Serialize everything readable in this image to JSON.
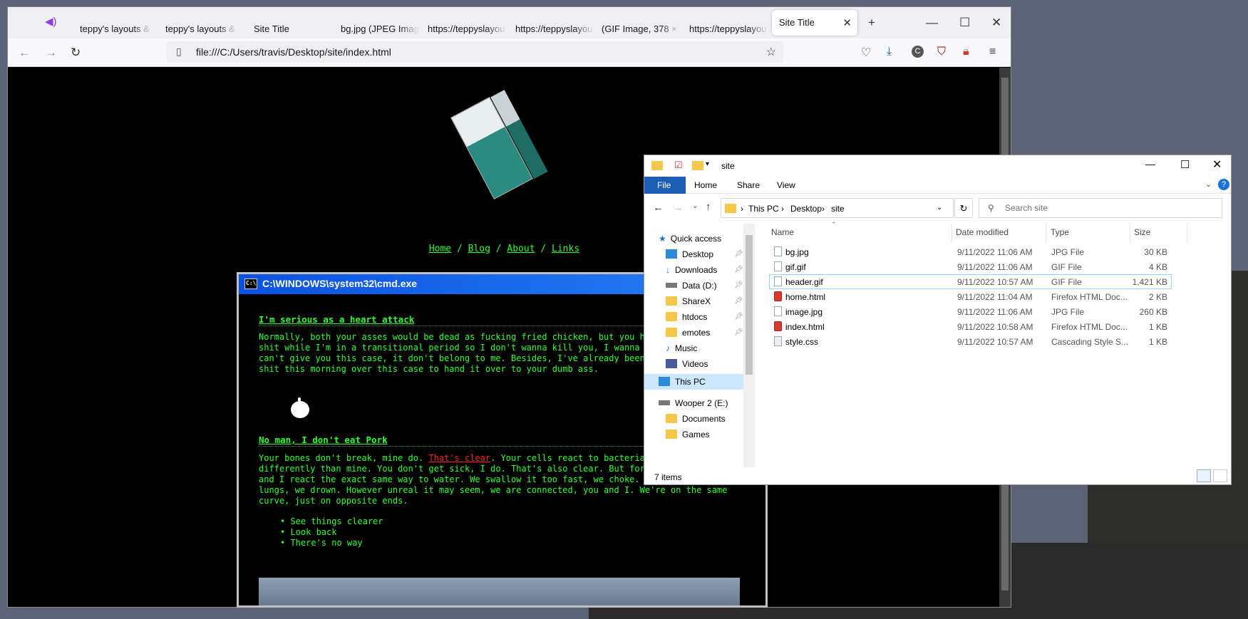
{
  "browser": {
    "tabs": [
      {
        "label": "teppy's layouts & t"
      },
      {
        "label": "teppy's layouts & t"
      },
      {
        "label": "Site Title"
      },
      {
        "label": "bg.jpg (JPEG Image"
      },
      {
        "label": "https://teppyslayou"
      },
      {
        "label": "https://teppyslayou"
      },
      {
        "label": "(GIF Image, 378 × 3"
      },
      {
        "label": "https://teppyslayou"
      },
      {
        "label": "Site Title"
      }
    ],
    "url": "file:///C:/Users/travis/Desktop/site/index.html"
  },
  "site": {
    "nav": [
      "Home",
      "Blog",
      "About",
      "Links"
    ],
    "nav_sep": "/"
  },
  "cmd": {
    "title": "C:\\WINDOWS\\system32\\cmd.exe",
    "heading1": "I'm serious as a heart attack",
    "para1": "Normally, both your asses would be dead as fucking fried chicken, but you ha\nshit while I'm in a transitional period so I don't wanna kill you, I wanna h\ncan't give you this case, it don't belong to me. Besides, I've already been\nshit this morning over this case to hand it over to your dumb ass.",
    "heading2": "No man, I don't eat Pork",
    "para2_a": "Your bones don't break, mine do. ",
    "para2_link": "That's clear",
    "para2_b": ". Your cells react to bacteria",
    "para2_rest": "differently than mine. You don't get sick, I do. That's also clear. But for\nand I react the exact same way to water. We swallow it too fast, we choke. W\nlungs, we drown. However unreal it may seem, we are connected, you and I. We're on the same\ncurve, just on opposite ends.",
    "list": [
      "See things clearer",
      "Look back",
      "There's no way"
    ]
  },
  "explorer": {
    "title": "site",
    "ribbon": [
      "File",
      "Home",
      "Share",
      "View"
    ],
    "breadcrumb": [
      "This PC",
      "Desktop",
      "site"
    ],
    "search_placeholder": "Search site",
    "nav": {
      "quick_access": "Quick access",
      "items": [
        "Desktop",
        "Downloads",
        "Data (D:)",
        "ShareX",
        "htdocs",
        "emotes",
        "Music",
        "Videos"
      ],
      "this_pc": "This PC",
      "drive": "Wooper 2 (E:)",
      "drive_items": [
        "Documents",
        "Games"
      ]
    },
    "columns": [
      "Name",
      "Date modified",
      "Type",
      "Size"
    ],
    "files": [
      {
        "name": "bg.jpg",
        "date": "9/11/2022 11:06 AM",
        "type": "JPG File",
        "size": "30 KB"
      },
      {
        "name": "gif.gif",
        "date": "9/11/2022 11:06 AM",
        "type": "GIF File",
        "size": "4 KB"
      },
      {
        "name": "header.gif",
        "date": "9/11/2022 10:57 AM",
        "type": "GIF File",
        "size": "1,421 KB"
      },
      {
        "name": "home.html",
        "date": "9/11/2022 11:04 AM",
        "type": "Firefox HTML Doc...",
        "size": "2 KB"
      },
      {
        "name": "image.jpg",
        "date": "9/11/2022 11:06 AM",
        "type": "JPG File",
        "size": "260 KB"
      },
      {
        "name": "index.html",
        "date": "9/11/2022 10:58 AM",
        "type": "Firefox HTML Doc...",
        "size": "1 KB"
      },
      {
        "name": "style.css",
        "date": "9/11/2022 10:57 AM",
        "type": "Cascading Style S...",
        "size": "1 KB"
      }
    ],
    "status": "7 items"
  }
}
